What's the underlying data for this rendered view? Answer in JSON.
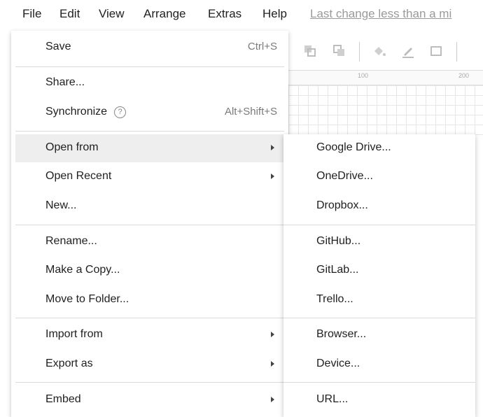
{
  "menubar": {
    "items": [
      "File",
      "Edit",
      "View",
      "Arrange",
      "Extras",
      "Help"
    ],
    "last_change": "Last change less than a mi"
  },
  "ruler": {
    "labels": [
      "100",
      "200"
    ]
  },
  "file_menu": {
    "save": {
      "label": "Save",
      "shortcut": "Ctrl+S"
    },
    "share": {
      "label": "Share..."
    },
    "synchronize": {
      "label": "Synchronize",
      "shortcut": "Alt+Shift+S",
      "help_glyph": "?"
    },
    "open_from": {
      "label": "Open from"
    },
    "open_recent": {
      "label": "Open Recent"
    },
    "new": {
      "label": "New..."
    },
    "rename": {
      "label": "Rename..."
    },
    "make_copy": {
      "label": "Make a Copy..."
    },
    "move_to_folder": {
      "label": "Move to Folder..."
    },
    "import_from": {
      "label": "Import from"
    },
    "export_as": {
      "label": "Export as"
    },
    "embed": {
      "label": "Embed"
    }
  },
  "open_from_submenu": {
    "items": [
      "Google Drive...",
      "OneDrive...",
      "Dropbox...",
      "GitHub...",
      "GitLab...",
      "Trello...",
      "Browser...",
      "Device...",
      "URL..."
    ]
  },
  "colors": {
    "highlight": "#eeeeee",
    "separator": "#d9d9d9",
    "muted_text": "#9a9a9a"
  }
}
